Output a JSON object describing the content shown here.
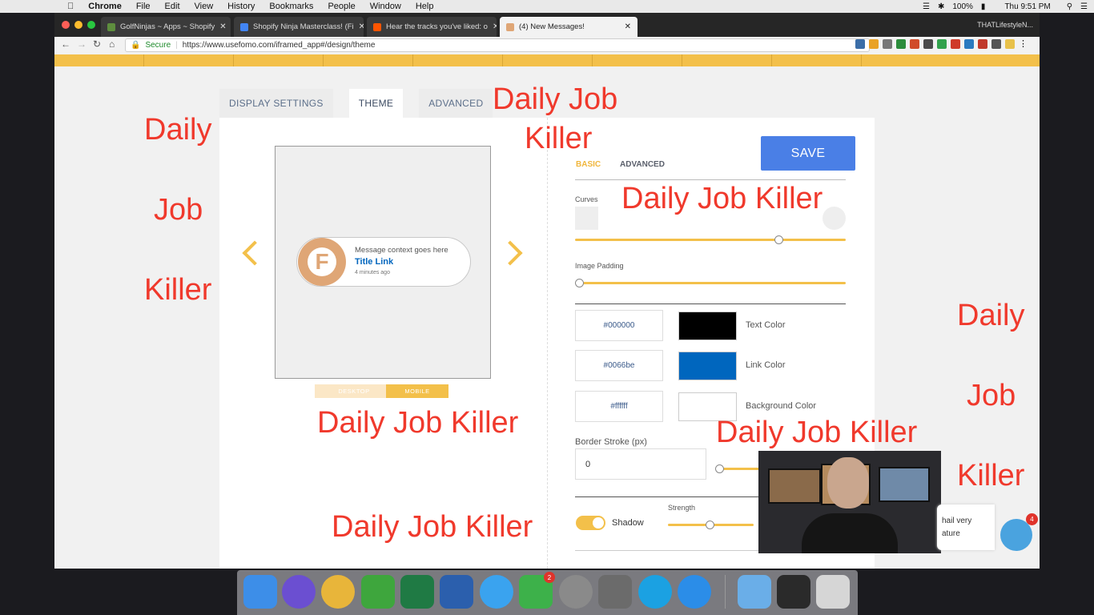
{
  "menubar": {
    "app": "Chrome",
    "items": [
      "File",
      "Edit",
      "View",
      "History",
      "Bookmarks",
      "People",
      "Window",
      "Help"
    ],
    "battery": "100%",
    "clock": "Thu 9:51 PM"
  },
  "tabs": [
    {
      "title": "GolfNinjas ~ Apps ~ Shopify",
      "color": "#5e8e3e"
    },
    {
      "title": "Shopify Ninja Masterclass! (Fi",
      "color": "#4285f4"
    },
    {
      "title": "Hear the tracks you've liked: o",
      "color": "#ff5500"
    },
    {
      "title": "(4) New Messages!",
      "color": "#dfa676"
    }
  ],
  "profile": "THATLifestyleN...",
  "omnibox": {
    "secure": "Secure",
    "url": "https://www.usefomo.com/iframed_app#/design/theme"
  },
  "page_tabs": [
    {
      "label": "DISPLAY SETTINGS"
    },
    {
      "label": "THEME"
    },
    {
      "label": "ADVANCED"
    }
  ],
  "preview": {
    "message": "Message context goes here",
    "title_link": "Title Link",
    "time": "4 minutes ago",
    "logo_letter": "F"
  },
  "device_buttons": {
    "desktop": "DESKTOP",
    "mobile": "MOBILE"
  },
  "settings": {
    "save": "SAVE",
    "subtab_basic": "BASIC",
    "subtab_advanced": "ADVANCED",
    "curves_label": "Curves",
    "curves_value": 0.75,
    "image_padding_label": "Image Padding",
    "image_padding_value": 0,
    "colors": [
      {
        "hex": "#000000",
        "label": "Text Color",
        "swatch": "#000000"
      },
      {
        "hex": "#0066be",
        "label": "Link Color",
        "swatch": "#0066be"
      },
      {
        "hex": "#ffffff",
        "label": "Background Color",
        "swatch": "#ffffff"
      }
    ],
    "border_stroke_label": "Border Stroke (px)",
    "border_stroke_value": "0",
    "shadow_label": "Shadow",
    "strength_label": "Strength"
  },
  "watermark": {
    "full": "Daily Job Killer",
    "w1": "Daily",
    "w2": "Job",
    "w3": "Killer",
    "top1": "Daily Job",
    "top2": "Killer"
  },
  "chat": {
    "line1": "hail very",
    "line2": "ature",
    "badge": "4"
  },
  "dock": {
    "facetime_badge": "2"
  }
}
